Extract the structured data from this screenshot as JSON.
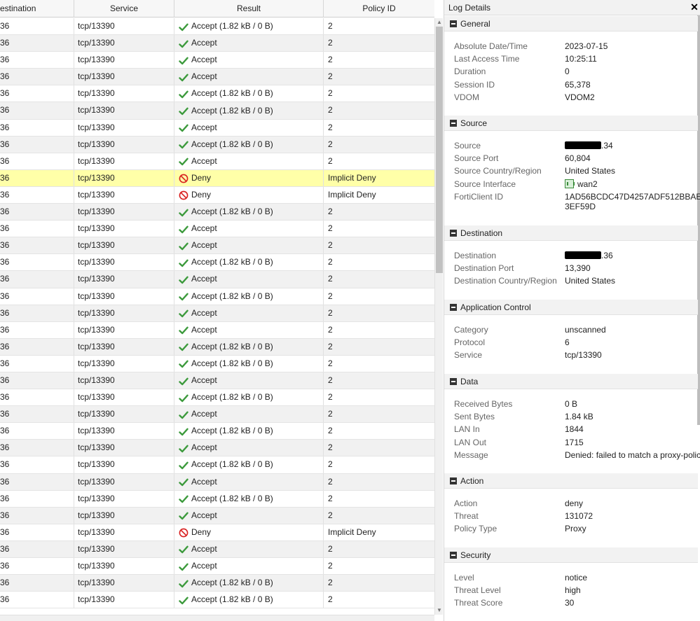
{
  "table": {
    "columns": [
      "estination",
      "Service",
      "Result",
      "Policy ID"
    ],
    "rows": [
      {
        "dest": "36",
        "service": "tcp/13390",
        "result": "Accept (1.82 kB / 0 B)",
        "status": "accept",
        "policy": "2"
      },
      {
        "dest": "36",
        "service": "tcp/13390",
        "result": "Accept",
        "status": "accept",
        "policy": "2"
      },
      {
        "dest": "36",
        "service": "tcp/13390",
        "result": "Accept",
        "status": "accept",
        "policy": "2"
      },
      {
        "dest": "36",
        "service": "tcp/13390",
        "result": "Accept",
        "status": "accept",
        "policy": "2"
      },
      {
        "dest": "36",
        "service": "tcp/13390",
        "result": "Accept (1.82 kB / 0 B)",
        "status": "accept",
        "policy": "2"
      },
      {
        "dest": "36",
        "service": "tcp/13390",
        "result": "Accept (1.82 kB / 0 B)",
        "status": "accept",
        "policy": "2"
      },
      {
        "dest": "36",
        "service": "tcp/13390",
        "result": "Accept",
        "status": "accept",
        "policy": "2"
      },
      {
        "dest": "36",
        "service": "tcp/13390",
        "result": "Accept (1.82 kB / 0 B)",
        "status": "accept",
        "policy": "2"
      },
      {
        "dest": "36",
        "service": "tcp/13390",
        "result": "Accept",
        "status": "accept",
        "policy": "2"
      },
      {
        "dest": "36",
        "service": "tcp/13390",
        "result": "Deny",
        "status": "deny",
        "policy": "Implicit Deny",
        "selected": true
      },
      {
        "dest": "36",
        "service": "tcp/13390",
        "result": "Deny",
        "status": "deny",
        "policy": "Implicit Deny"
      },
      {
        "dest": "36",
        "service": "tcp/13390",
        "result": "Accept (1.82 kB / 0 B)",
        "status": "accept",
        "policy": "2"
      },
      {
        "dest": "36",
        "service": "tcp/13390",
        "result": "Accept",
        "status": "accept",
        "policy": "2"
      },
      {
        "dest": "36",
        "service": "tcp/13390",
        "result": "Accept",
        "status": "accept",
        "policy": "2"
      },
      {
        "dest": "36",
        "service": "tcp/13390",
        "result": "Accept (1.82 kB / 0 B)",
        "status": "accept",
        "policy": "2"
      },
      {
        "dest": "36",
        "service": "tcp/13390",
        "result": "Accept",
        "status": "accept",
        "policy": "2"
      },
      {
        "dest": "36",
        "service": "tcp/13390",
        "result": "Accept (1.82 kB / 0 B)",
        "status": "accept",
        "policy": "2"
      },
      {
        "dest": "36",
        "service": "tcp/13390",
        "result": "Accept",
        "status": "accept",
        "policy": "2"
      },
      {
        "dest": "36",
        "service": "tcp/13390",
        "result": "Accept",
        "status": "accept",
        "policy": "2"
      },
      {
        "dest": "36",
        "service": "tcp/13390",
        "result": "Accept (1.82 kB / 0 B)",
        "status": "accept",
        "policy": "2"
      },
      {
        "dest": "36",
        "service": "tcp/13390",
        "result": "Accept (1.82 kB / 0 B)",
        "status": "accept",
        "policy": "2"
      },
      {
        "dest": "36",
        "service": "tcp/13390",
        "result": "Accept",
        "status": "accept",
        "policy": "2"
      },
      {
        "dest": "36",
        "service": "tcp/13390",
        "result": "Accept (1.82 kB / 0 B)",
        "status": "accept",
        "policy": "2"
      },
      {
        "dest": "36",
        "service": "tcp/13390",
        "result": "Accept",
        "status": "accept",
        "policy": "2"
      },
      {
        "dest": "36",
        "service": "tcp/13390",
        "result": "Accept (1.82 kB / 0 B)",
        "status": "accept",
        "policy": "2"
      },
      {
        "dest": "36",
        "service": "tcp/13390",
        "result": "Accept",
        "status": "accept",
        "policy": "2"
      },
      {
        "dest": "36",
        "service": "tcp/13390",
        "result": "Accept (1.82 kB / 0 B)",
        "status": "accept",
        "policy": "2"
      },
      {
        "dest": "36",
        "service": "tcp/13390",
        "result": "Accept",
        "status": "accept",
        "policy": "2"
      },
      {
        "dest": "36",
        "service": "tcp/13390",
        "result": "Accept (1.82 kB / 0 B)",
        "status": "accept",
        "policy": "2"
      },
      {
        "dest": "36",
        "service": "tcp/13390",
        "result": "Accept",
        "status": "accept",
        "policy": "2"
      },
      {
        "dest": "36",
        "service": "tcp/13390",
        "result": "Deny",
        "status": "deny",
        "policy": "Implicit Deny"
      },
      {
        "dest": "36",
        "service": "tcp/13390",
        "result": "Accept",
        "status": "accept",
        "policy": "2"
      },
      {
        "dest": "36",
        "service": "tcp/13390",
        "result": "Accept",
        "status": "accept",
        "policy": "2"
      },
      {
        "dest": "36",
        "service": "tcp/13390",
        "result": "Accept (1.82 kB / 0 B)",
        "status": "accept",
        "policy": "2"
      },
      {
        "dest": "36",
        "service": "tcp/13390",
        "result": "Accept (1.82 kB / 0 B)",
        "status": "accept",
        "policy": "2"
      }
    ]
  },
  "details": {
    "title": "Log Details",
    "close_icon": "close-icon",
    "sections": {
      "general": {
        "title": "General",
        "items": [
          {
            "key": "Absolute Date/Time",
            "value": "2023-07-15"
          },
          {
            "key": "Last Access Time",
            "value": "10:25:11"
          },
          {
            "key": "Duration",
            "value": "0"
          },
          {
            "key": "Session ID",
            "value": "65,378"
          },
          {
            "key": "VDOM",
            "value": "VDOM2"
          }
        ]
      },
      "source": {
        "title": "Source",
        "source_key": "Source",
        "source_suffix": ".34",
        "items": [
          {
            "key": "Source Port",
            "value": "60,804"
          },
          {
            "key": "Source Country/Region",
            "value": "United States"
          }
        ],
        "interface_key": "Source Interface",
        "interface_value": "wan2",
        "forticlient_key": "FortiClient ID",
        "forticlient_line1": "1AD56BCDC47D4257ADF512BBAE",
        "forticlient_line2": "3EF59D"
      },
      "destination": {
        "title": "Destination",
        "dest_key": "Destination",
        "dest_suffix": ".36",
        "items": [
          {
            "key": "Destination Port",
            "value": "13,390"
          },
          {
            "key": "Destination Country/Region",
            "value": "United States"
          }
        ]
      },
      "appctrl": {
        "title": "Application Control",
        "items": [
          {
            "key": "Category",
            "value": "unscanned"
          },
          {
            "key": "Protocol",
            "value": "6"
          },
          {
            "key": "Service",
            "value": "tcp/13390"
          }
        ]
      },
      "data": {
        "title": "Data",
        "items": [
          {
            "key": "Received Bytes",
            "value": "0 B"
          },
          {
            "key": "Sent Bytes",
            "value": "1.84 kB"
          },
          {
            "key": "LAN In",
            "value": "1844"
          },
          {
            "key": "LAN Out",
            "value": "1715"
          },
          {
            "key": "Message",
            "value": "Denied: failed to match a proxy-policy"
          }
        ]
      },
      "action": {
        "title": "Action",
        "items": [
          {
            "key": "Action",
            "value": "deny"
          },
          {
            "key": "Threat",
            "value": "131072"
          },
          {
            "key": "Policy Type",
            "value": "Proxy"
          }
        ]
      },
      "security": {
        "title": "Security",
        "items": [
          {
            "key": "Level",
            "value": "notice"
          },
          {
            "key": "Threat Level",
            "value": "high"
          },
          {
            "key": "Threat Score",
            "value": "30"
          }
        ]
      }
    }
  },
  "colors": {
    "accept_icon": "#3c9a3c",
    "deny_icon": "#d81e1e",
    "selected_row": "#ffffa8"
  }
}
